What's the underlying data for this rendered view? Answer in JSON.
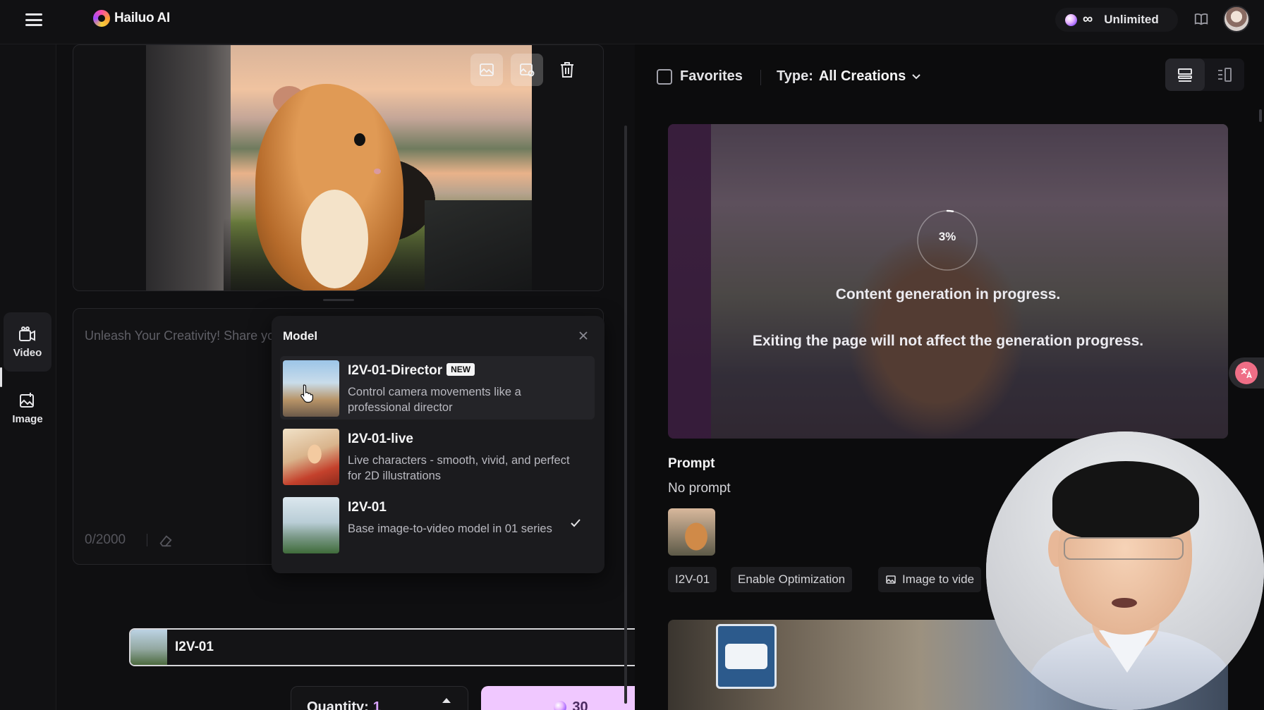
{
  "app": {
    "brand_name": "Hailuo AI",
    "plan_label": "Unlimited",
    "infinity_symbol": "∞"
  },
  "rail": {
    "items": [
      {
        "label": "Video",
        "icon": "video-icon",
        "active": true
      },
      {
        "label": "Image",
        "icon": "image-icon",
        "active": false
      }
    ]
  },
  "left": {
    "prompt_placeholder": "Unleash Your Creativity! Share your ideas...",
    "char_count": "0/2000",
    "model_popup": {
      "title": "Model",
      "options": [
        {
          "name": "I2V-01-Director",
          "badge": "NEW",
          "description": "Control camera movements like a professional director",
          "selected": false
        },
        {
          "name": "I2V-01-live",
          "badge": "",
          "description": "Live characters - smooth, vivid, and perfect for 2D illustrations",
          "selected": false
        },
        {
          "name": "I2V-01",
          "badge": "",
          "description": "Base image-to-video model in 01 series",
          "selected": true
        }
      ]
    },
    "selected_model": "I2V-01",
    "quantity_label": "Quantity:",
    "quantity_value": "1",
    "generate_cost": "30"
  },
  "right": {
    "favorites_label": "Favorites",
    "type_label": "Type:",
    "type_value": "All Creations",
    "generation": {
      "progress_percent": 3,
      "progress_label": "3%",
      "message_1": "Content generation in progress.",
      "message_2": "Exiting the page will not affect the generation progress."
    },
    "prompt_heading": "Prompt",
    "prompt_text": "No prompt",
    "tags": [
      "I2V-01",
      "Enable Optimization",
      "Image to vide"
    ]
  },
  "colors": {
    "accent": "#f0c8ff",
    "accent_text": "#d9a4ff",
    "background": "#0d0d0e"
  }
}
